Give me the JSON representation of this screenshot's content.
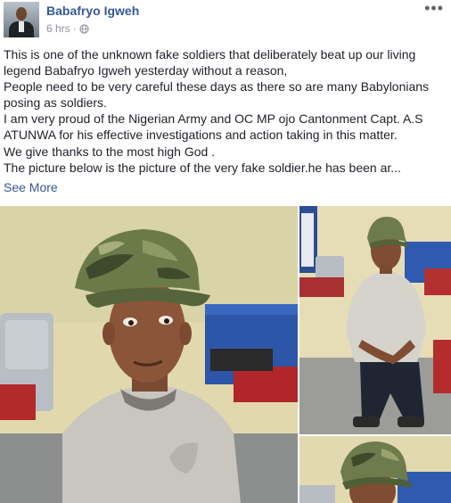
{
  "post": {
    "author": "Babafryo Igweh",
    "time": "6 hrs",
    "separator": "·",
    "privacy_icon": "globe-icon",
    "options_icon": "more-options-icon",
    "options_glyph": "•••",
    "lines": [
      "This is one of the unknown fake soldiers that deliberately beat up our living",
      "legend Babafryo Igweh yesterday without a reason,",
      "People need to be very careful these days as there so are many Babylonians",
      "posing as soldiers.",
      "I am very proud of the Nigerian Army and OC MP ojo Cantonment Capt. A.S",
      "ATUNWA for his effective investigations and action taking in this matter.",
      "We give thanks to the most high God .",
      "The picture below is the picture of the very fake soldier.he has been ar..."
    ],
    "see_more": "See More"
  },
  "colors": {
    "link": "#365899",
    "meta": "#90949c",
    "text": "#1d2129"
  }
}
